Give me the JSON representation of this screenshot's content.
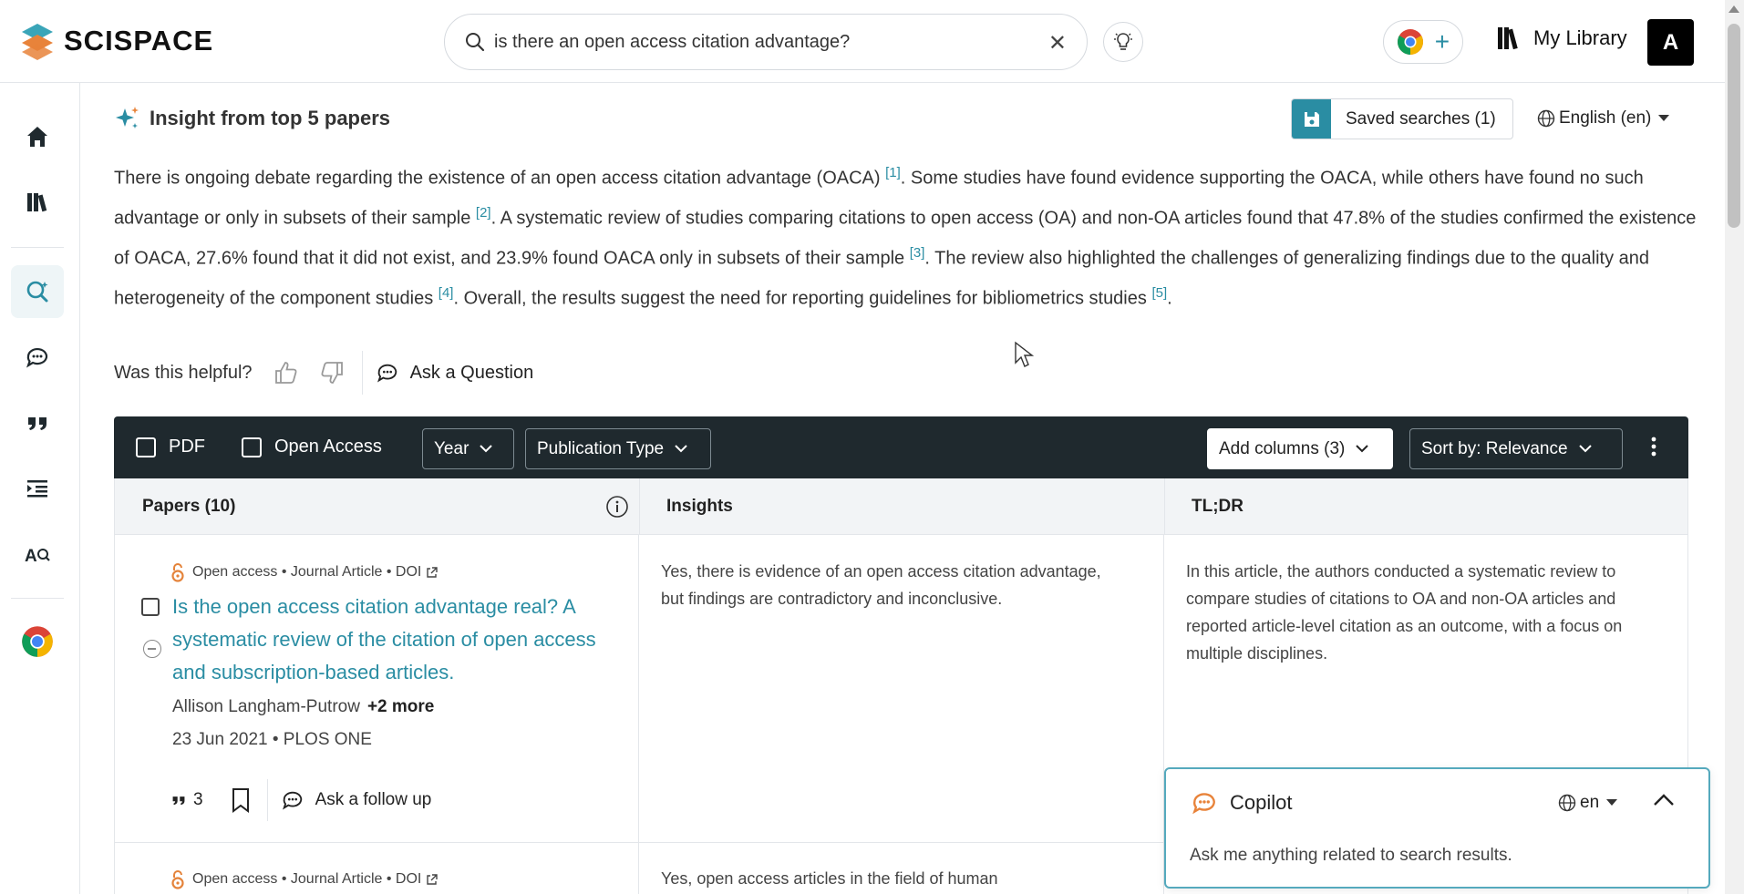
{
  "brand": {
    "name": "SCISPACE"
  },
  "search": {
    "query": "is there an open access citation advantage?",
    "placeholder": ""
  },
  "header": {
    "my_library": "My Library",
    "avatar_initial": "A"
  },
  "colors": {
    "accent": "#2a8da3",
    "filter_bar": "#1f292e",
    "open_access": "#e4833a",
    "logo_teal": "#3aa5b8",
    "logo_orange": "#e8833a"
  },
  "insight": {
    "title": "Insight from top 5 papers",
    "saved_searches": "Saved searches (1)",
    "language": "English (en)",
    "summary": [
      {
        "text": "There is ongoing debate regarding the existence of an open access citation advantage (OACA) ",
        "ref": "[1]"
      },
      {
        "text": ". Some studies have found evidence supporting the OACA, while others have found no such advantage or only in subsets of their sample ",
        "ref": "[2]"
      },
      {
        "text": ". A systematic review of studies comparing citations to open access (OA) and non-OA articles found that 47.8% of the studies confirmed the existence of OACA, 27.6% found that it did not exist, and 23.9% found OACA only in subsets of their sample ",
        "ref": "[3]"
      },
      {
        "text": ". The review also highlighted the challenges of generalizing findings due to the quality and heterogeneity of the component studies ",
        "ref": "[4]"
      },
      {
        "text": ". Overall, the results suggest the need for reporting guidelines for bibliometrics studies ",
        "ref": "[5]"
      },
      {
        "text": ".",
        "ref": ""
      }
    ],
    "helpful_label": "Was this helpful?",
    "ask_question": "Ask a Question"
  },
  "filters": {
    "pdf": "PDF",
    "open_access": "Open Access",
    "year": "Year",
    "publication_type": "Publication Type",
    "add_columns": "Add columns (3)",
    "sort_by": "Sort by: Relevance"
  },
  "table": {
    "headers": {
      "papers": "Papers (10)",
      "insights": "Insights",
      "tldr": "TL;DR"
    },
    "rows": [
      {
        "meta": {
          "access": "Open access",
          "sep1": "•",
          "type": "Journal Article",
          "sep2": "•",
          "doi": "DOI"
        },
        "title": "Is the open access citation advantage real? A systematic review of the citation of open access and subscription-based articles.",
        "author": "Allison Langham-Putrow",
        "more_authors": "+2 more",
        "date_venue": "23 Jun 2021 • PLOS ONE",
        "citations": "3",
        "follow_up": "Ask a follow up",
        "insight": "Yes, there is evidence of an open access citation advantage, but findings are contradictory and inconclusive.",
        "tldr": "In this article, the authors conducted a systematic review to compare studies of citations to OA and non-OA articles and reported article-level citation as an outcome, with a focus on multiple disciplines."
      },
      {
        "meta": {
          "access": "Open access",
          "sep1": "•",
          "type": "Journal Article",
          "sep2": "•",
          "doi": "DOI"
        },
        "insight": "Yes, open access articles in the field of human"
      }
    ]
  },
  "copilot": {
    "title": "Copilot",
    "language": "en",
    "hint": "Ask me anything related to search results."
  },
  "icons": {
    "sidebar": [
      "home-icon",
      "library-icon",
      "search-insight-icon",
      "chat-icon",
      "quote-icon",
      "outline-icon",
      "ai-detector-icon",
      "chrome-icon"
    ]
  }
}
